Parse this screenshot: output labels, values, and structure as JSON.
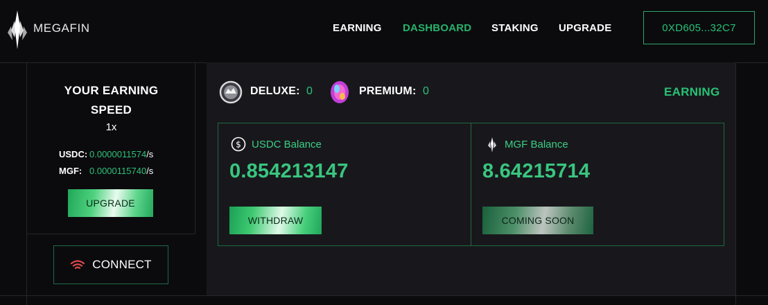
{
  "header": {
    "brand": "MEGAFIN",
    "logo_icon": "megafin-diamond-logo",
    "nav": [
      {
        "label": "EARNING",
        "active": false
      },
      {
        "label": "DASHBOARD",
        "active": true
      },
      {
        "label": "STAKING",
        "active": false
      },
      {
        "label": "UPGRADE",
        "active": false
      }
    ],
    "wallet_address": "0XD605...32C7"
  },
  "sidebar": {
    "title_line1": "YOUR EARNING",
    "title_line2": "SPEED",
    "multiplier": "1x",
    "rates": [
      {
        "label": "USDC:",
        "value": "0.0000011574",
        "unit": "/s"
      },
      {
        "label": "MGF:",
        "value": "0.0000115740",
        "unit": "/s"
      }
    ],
    "upgrade_label": "UPGRADE",
    "connect_label": "CONNECT",
    "connect_icon": "wifi-signal-icon"
  },
  "main": {
    "tiers": [
      {
        "label": "DELUXE:",
        "count": "0",
        "icon": "deluxe-badge-icon"
      },
      {
        "label": "PREMIUM:",
        "count": "0",
        "icon": "premium-badge-icon"
      }
    ],
    "earning_tab": "EARNING",
    "usdc": {
      "label": "USDC Balance",
      "value": "0.854213147",
      "icon": "dollar-circle-icon",
      "button": "WITHDRAW"
    },
    "mgf": {
      "label": "MGF Balance",
      "value": "8.64215714",
      "icon": "megafin-diamond-icon",
      "button": "COMING SOON"
    }
  },
  "colors": {
    "accent_green": "#27c275",
    "background": "#0b0b0e",
    "panel": "#18181c",
    "connect_icon": "#e24a4a"
  }
}
